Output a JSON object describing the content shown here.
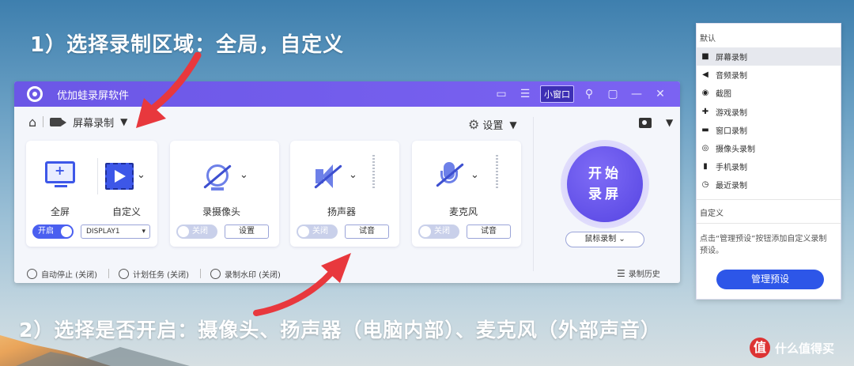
{
  "captions": {
    "step1": "1）选择录制区域：全局，自定义",
    "step2": "2）选择是否开启：摄像头、扬声器（电脑内部）、麦克风（外部声音）"
  },
  "app": {
    "title": "优加蛙录屏软件",
    "mini_window_label": "小窗口",
    "mode_label": "屏幕录制",
    "settings_label": "设置",
    "cards": {
      "fullscreen_label": "全屏",
      "custom_label": "自定义",
      "toggle_on_label": "开启",
      "display_select": "DISPLAY1",
      "camera_label": "录摄像头",
      "camera_toggle": "关闭",
      "camera_settings_button": "设置",
      "speaker_label": "扬声器",
      "speaker_toggle": "关闭",
      "speaker_test_button": "试音",
      "mic_label": "麦克风",
      "mic_toggle": "关闭",
      "mic_test_button": "试音"
    },
    "start_button": {
      "line1": "开始",
      "line2": "录屏"
    },
    "mouse_mode_select": "鼠标录制",
    "footer": {
      "auto_stop": "自动停止 (关闭)",
      "schedule": "计划任务 (关闭)",
      "watermark": "录制水印 (关闭)",
      "history": "录制历史"
    }
  },
  "preset_panel": {
    "default_heading": "默认",
    "items": [
      {
        "label": "屏幕录制",
        "icon": "video-icon",
        "glyph": "■"
      },
      {
        "label": "音频录制",
        "icon": "speaker-icon",
        "glyph": "◀"
      },
      {
        "label": "截图",
        "icon": "camera-icon",
        "glyph": "◉"
      },
      {
        "label": "游戏录制",
        "icon": "gamepad-icon",
        "glyph": "✚"
      },
      {
        "label": "窗口录制",
        "icon": "window-icon",
        "glyph": "▬"
      },
      {
        "label": "摄像头录制",
        "icon": "webcam-icon",
        "glyph": "◎"
      },
      {
        "label": "手机录制",
        "icon": "phone-icon",
        "glyph": "▮"
      },
      {
        "label": "最近录制",
        "icon": "clock-icon",
        "glyph": "◷"
      }
    ],
    "custom_heading": "自定义",
    "hint": "点击“管理预设”按钮添加自定义录制预设。",
    "manage_button": "管理预设"
  },
  "watermark_text": "什么值得买",
  "colors": {
    "accent": "#6b57e6",
    "primary_blue": "#3d57e8",
    "manage_button": "#2d56e8",
    "arrow_red": "#e8383d"
  }
}
